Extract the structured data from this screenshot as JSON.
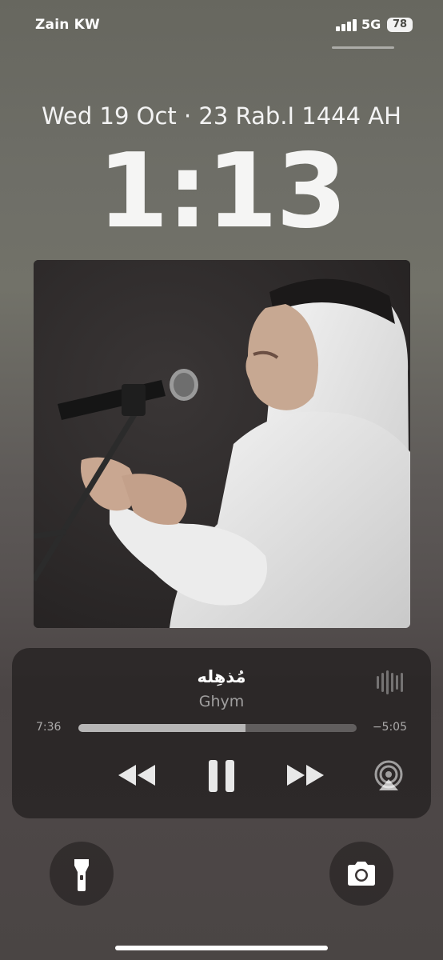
{
  "status_bar": {
    "carrier": "Zain KW",
    "network": "5G",
    "battery": "78",
    "signal_bars": 4
  },
  "lock_screen": {
    "date_line": "Wed 19 Oct · 23 Rab.I 1444 AH",
    "time": "1:13"
  },
  "now_playing": {
    "artwork_icon": "album-artwork",
    "title": "مُذهِله",
    "artist": "Ghym",
    "elapsed": "7:36",
    "remaining": "−5:05",
    "progress": 0.6,
    "controls": {
      "previous": "rewind-icon",
      "play_pause": "pause-icon",
      "next": "fast-forward-icon",
      "output": "airplay-icon",
      "visualizer": "waveform-icon"
    }
  },
  "quick_actions": {
    "left": "flashlight-icon",
    "right": "camera-icon"
  },
  "colors": {
    "background_top": "#67675f",
    "background_bottom": "#4a4544",
    "player_background": "#262222",
    "text": "#ffffff"
  }
}
